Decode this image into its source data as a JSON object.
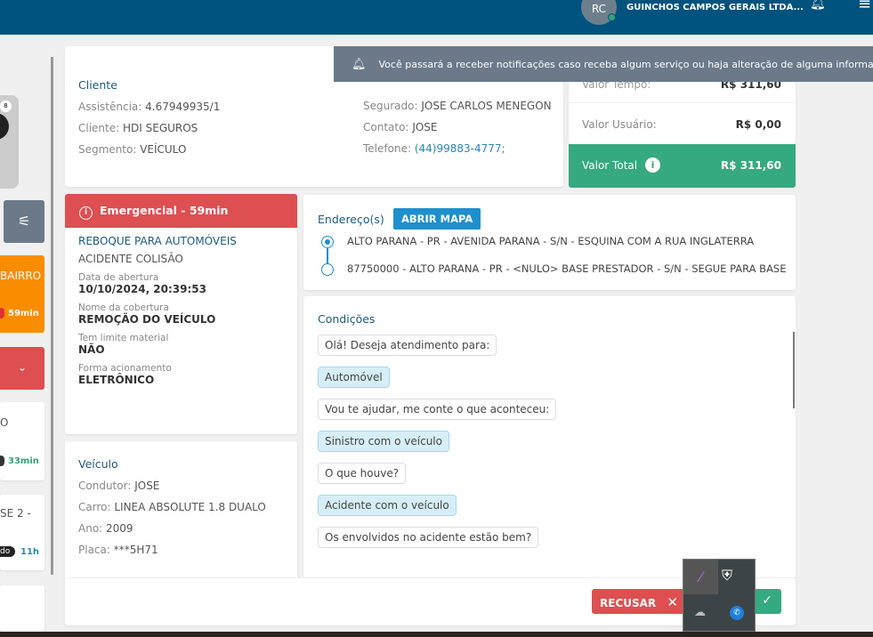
{
  "header": {
    "avatar": "RC",
    "company": "GUINCHOS CAMPOS GERAIS LTDA..."
  },
  "toast": {
    "text": "Você passará a receber notificações caso receba algum serviço ou haja alteração de alguma informação"
  },
  "sidebar": {
    "badge": "8",
    "card1_title": "BAIRRO",
    "card1_time": "59min",
    "card2_title": "O",
    "card2_time": "33min",
    "card3_title": "SE 2 -",
    "card3_tag": "do",
    "card3_time": "11h"
  },
  "cliente": {
    "title": "Cliente",
    "assist_label": "Assistência:",
    "assist": "4.67949935/1",
    "cliente_label": "Cliente:",
    "cliente": "HDI SEGUROS",
    "seg_label": "Segmento:",
    "seg": "VEÍCULO",
    "segurado_label": "Segurado:",
    "segurado": "JOSE CARLOS MENEGON",
    "contato_label": "Contato:",
    "contato": "JOSE",
    "tel_label": "Telefone:",
    "tel": "(44)99883-4777;"
  },
  "valores": {
    "tempo_label": "Valor Tempo:",
    "tempo": "R$ 311,60",
    "usuario_label": "Valor Usuário:",
    "usuario": "R$ 0,00",
    "total_label": "Valor Total",
    "total": "R$ 311,60"
  },
  "servico": {
    "banner": "Emergencial - 59min",
    "tipo": "REBOQUE PARA AUTOMÓVEIS",
    "motivo": "ACIDENTE COLISÃO",
    "data_label": "Data de abertura",
    "data": "10/10/2024, 20:39:53",
    "cob_label": "Nome da cobertura",
    "cob": "REMOÇÃO DO VEÍCULO",
    "lim_label": "Tem limite material",
    "lim": "NÃO",
    "forma_label": "Forma acionamento",
    "forma": "ELETRÔNICO"
  },
  "endereco": {
    "title": "Endereço(s)",
    "map_button": "ABRIR MAPA",
    "origem": "ALTO PARANA - PR - AVENIDA PARANA - S/N - ESQUINA COM A RUA INGLATERRA",
    "destino": "87750000 - ALTO PARANA - PR - <NULO> BASE PRESTADOR - S/N - SEGUE PARA BASE"
  },
  "veiculo": {
    "title": "Veículo",
    "cond_label": "Condutor:",
    "cond": "JOSE",
    "carro_label": "Carro:",
    "carro": "LINEA ABSOLUTE 1.8 DUALO",
    "ano_label": "Ano:",
    "ano": "2009",
    "placa_label": "Placa:",
    "placa": "***5H71"
  },
  "condicoes": {
    "title": "Condições",
    "messages": [
      {
        "t": "Olá! Deseja atendimento para:"
      },
      {
        "t": "Automóvel"
      },
      {
        "t": "Vou te ajudar, me conte o que aconteceu:"
      },
      {
        "t": "Sinistro com o veículo"
      },
      {
        "t": "O que houve?"
      },
      {
        "t": "Acidente com o veículo"
      },
      {
        "t": "Os envolvidos no acidente estão bem?"
      }
    ]
  },
  "actions": {
    "refuse": "RECUSAR"
  }
}
